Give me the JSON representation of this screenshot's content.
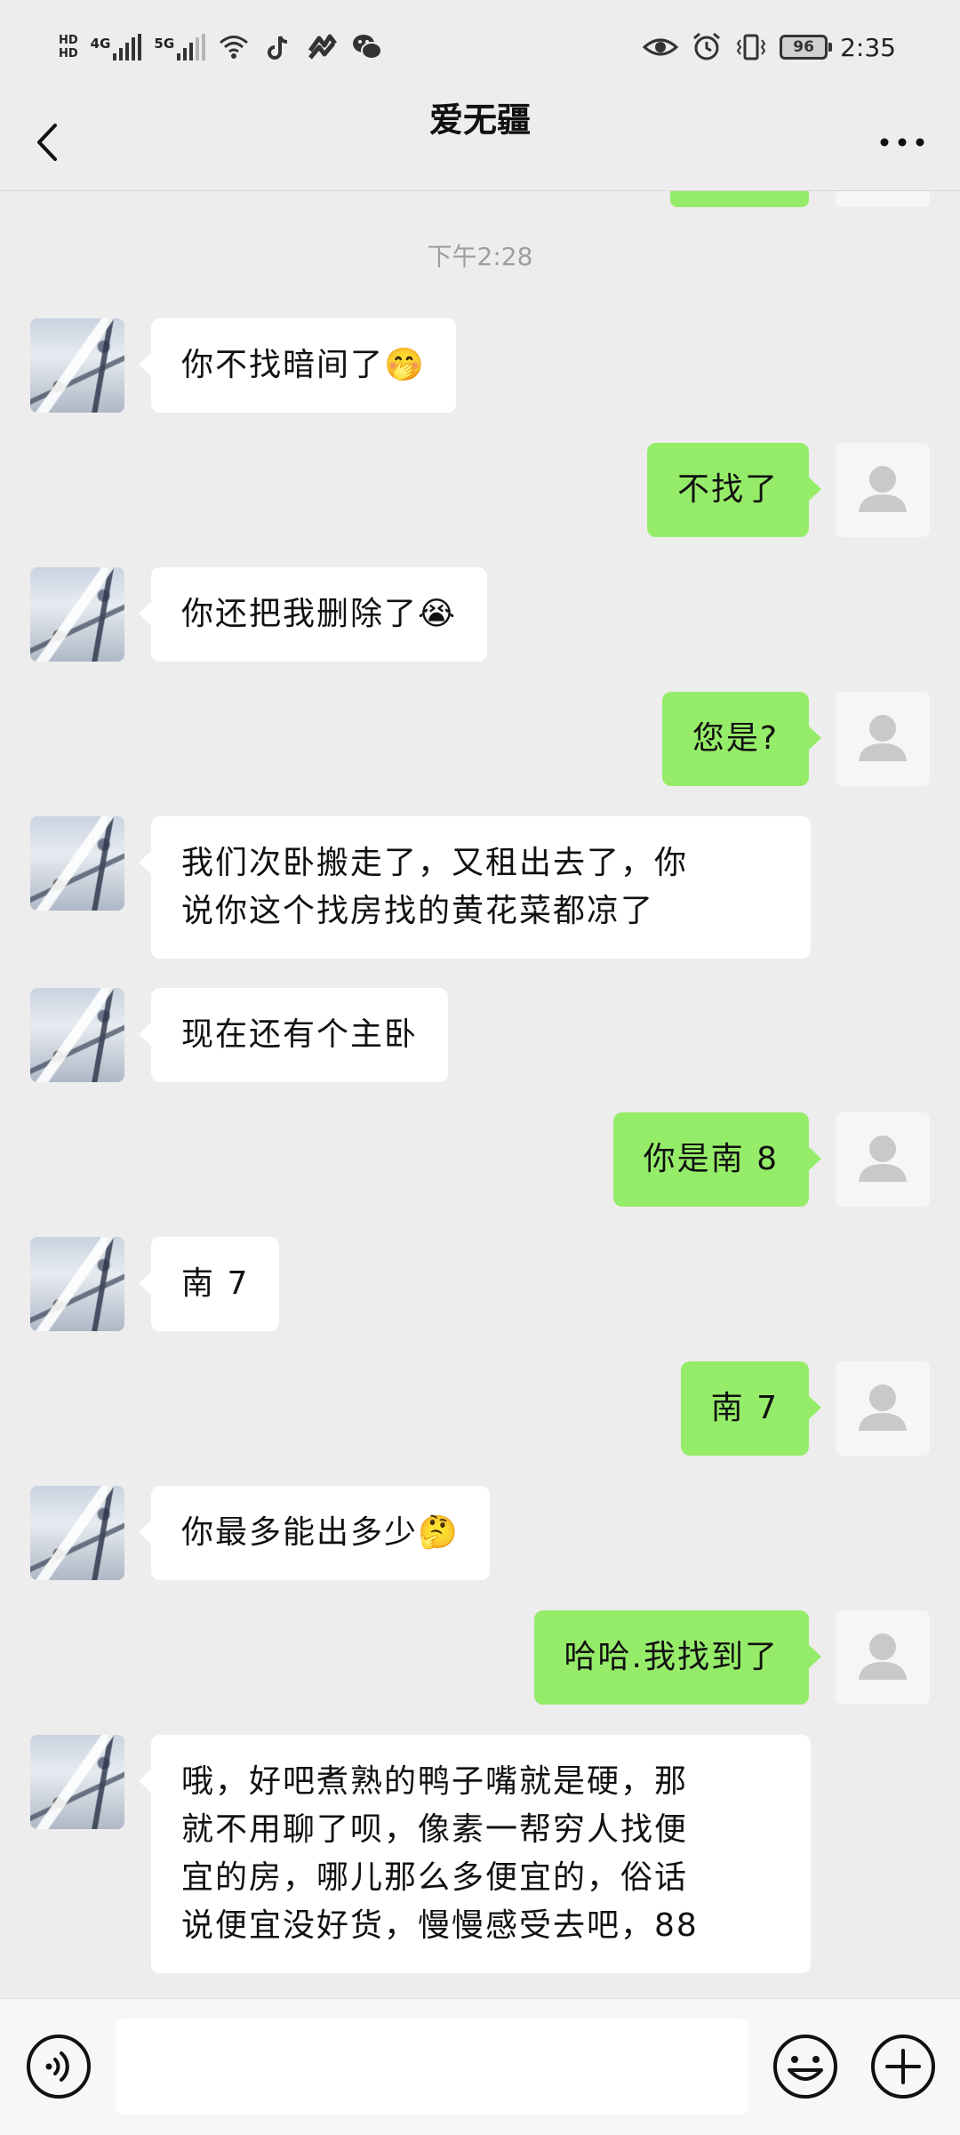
{
  "status_bar": {
    "hd_top": "HD",
    "hd_bottom": "HD",
    "net1": "4G",
    "net2": "5G",
    "battery": "96",
    "time": "2:35"
  },
  "header": {
    "title": "爱无疆"
  },
  "chat": {
    "timestamp": "下午2:28",
    "messages": [
      {
        "side": "in",
        "text": "你不找暗间了🤭"
      },
      {
        "side": "out",
        "text": "不找了"
      },
      {
        "side": "in",
        "text": "你还把我删除了😭"
      },
      {
        "side": "out",
        "text": "您是?"
      },
      {
        "side": "in",
        "line1": "我们次卧搬走了，又租出去了，你",
        "line2": "说你这个找房找的黄花菜都凉了"
      },
      {
        "side": "in",
        "text": "现在还有个主卧"
      },
      {
        "side": "out",
        "text": "你是南 8"
      },
      {
        "side": "in",
        "text": "南 7"
      },
      {
        "side": "out",
        "text": "南 7"
      },
      {
        "side": "in",
        "text": "你最多能出多少🤔"
      },
      {
        "side": "out",
        "text": "哈哈.我找到了"
      },
      {
        "side": "in",
        "line1": "哦，好吧煮熟的鸭子嘴就是硬，那",
        "line2": "就不用聊了呗，像素一帮穷人找便",
        "line3": "宜的房，哪儿那么多便宜的，俗话",
        "line4": "说便宜没好货，慢慢感受去吧，88"
      }
    ]
  },
  "input_bar": {
    "value": "",
    "placeholder": ""
  },
  "icons": {
    "back": "chevron-left-icon",
    "more": "more-dots-icon",
    "voice": "voice-icon",
    "emoji": "emoji-icon",
    "plus": "plus-icon"
  },
  "colors": {
    "background": "#ededed",
    "bubble_out": "#95ec69",
    "bubble_in": "#ffffff",
    "timestamp": "#9e9e9e"
  }
}
